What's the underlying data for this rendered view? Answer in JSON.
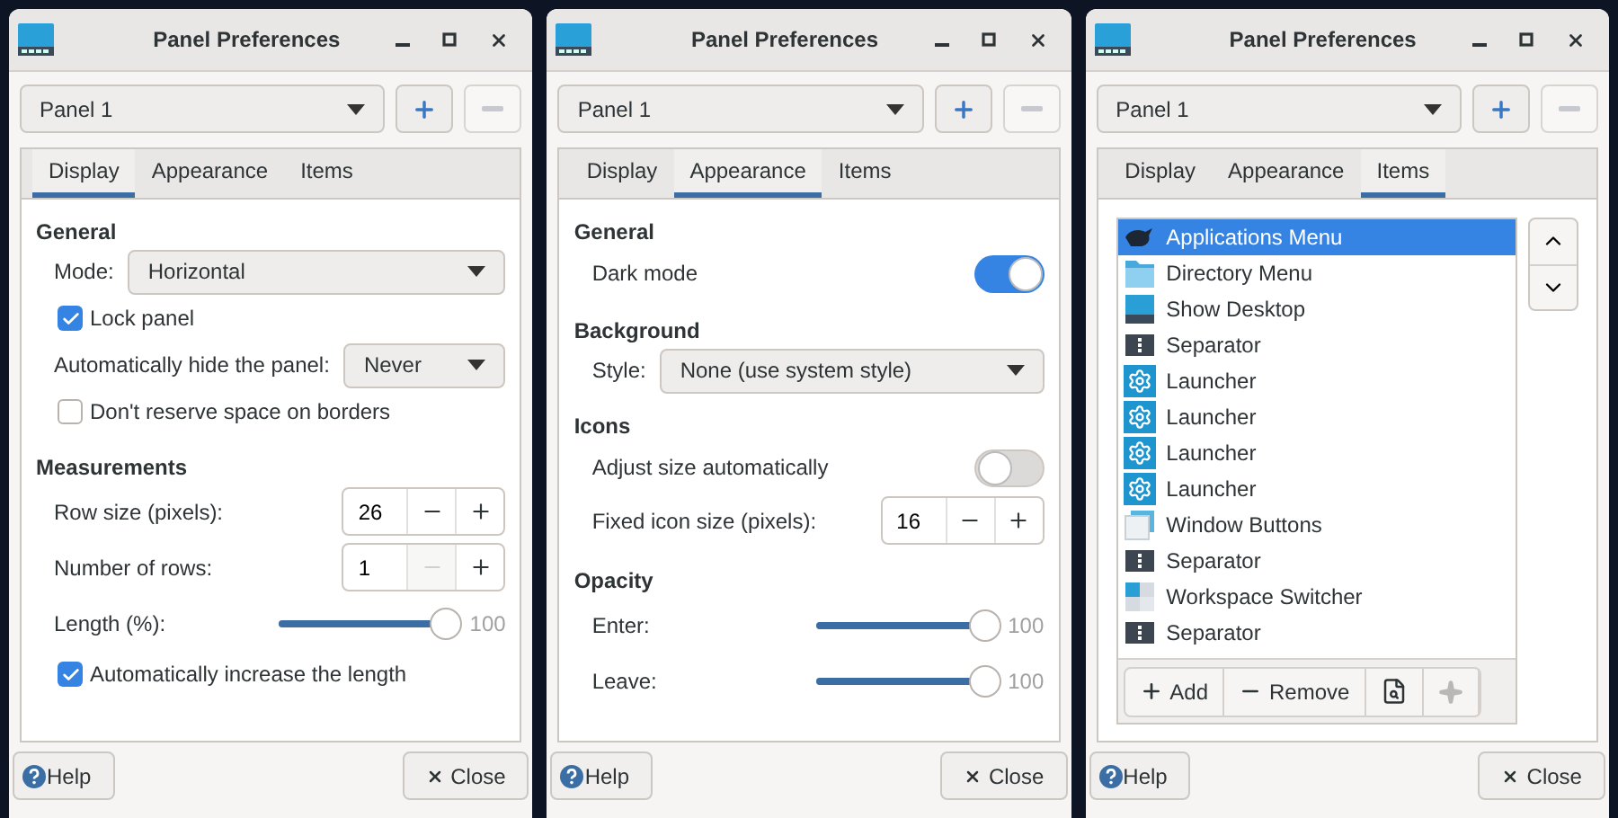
{
  "windows": [
    {
      "title": "Panel Preferences",
      "panel": {
        "value": "Panel 1",
        "remove_disabled": true
      },
      "tabs": [
        {
          "label": "Display",
          "selected": true
        },
        {
          "label": "Appearance",
          "selected": false
        },
        {
          "label": "Items",
          "selected": false
        }
      ],
      "page": {
        "kind": "form",
        "sections": [
          {
            "heading": "General",
            "rows": [
              {
                "kind": "dropdown",
                "label": "Mode:",
                "value": "Horizontal"
              },
              {
                "kind": "checkbox",
                "label": "Lock panel",
                "checked": true
              },
              {
                "kind": "dropdown",
                "label": "Automatically hide the panel:",
                "value": "Never"
              },
              {
                "kind": "checkbox",
                "label": "Don't reserve space on borders",
                "checked": false
              }
            ]
          },
          {
            "heading": "Measurements",
            "rows": [
              {
                "kind": "spin",
                "label": "Row size (pixels):",
                "value": "26",
                "decrement_disabled": false
              },
              {
                "kind": "spin",
                "label": "Number of rows:",
                "value": "1",
                "decrement_disabled": true
              },
              {
                "kind": "slider",
                "label": "Length (%):",
                "level": 1,
                "reading": "100"
              },
              {
                "kind": "checkbox",
                "label": "Automatically increase the length",
                "checked": true
              }
            ]
          }
        ]
      },
      "footer": {
        "help": "Help",
        "close": "Close"
      }
    },
    {
      "title": "Panel Preferences",
      "panel": {
        "value": "Panel 1",
        "remove_disabled": true
      },
      "tabs": [
        {
          "label": "Display",
          "selected": false
        },
        {
          "label": "Appearance",
          "selected": true
        },
        {
          "label": "Items",
          "selected": false
        }
      ],
      "page": {
        "kind": "form",
        "sections": [
          {
            "heading": "General",
            "rows": [
              {
                "kind": "switch",
                "label": "Dark mode",
                "on": true
              }
            ]
          },
          {
            "heading": "Background",
            "rows": [
              {
                "kind": "dropdown",
                "label": "Style:",
                "value": "None (use system style)"
              }
            ]
          },
          {
            "heading": "Icons",
            "rows": [
              {
                "kind": "switch",
                "label": "Adjust size automatically",
                "on": false
              },
              {
                "kind": "spin",
                "label": "Fixed icon size (pixels):",
                "value": "16",
                "decrement_disabled": false
              }
            ]
          },
          {
            "heading": "Opacity",
            "rows": [
              {
                "kind": "slider",
                "label": "Enter:",
                "level": 1,
                "reading": "100"
              },
              {
                "kind": "slider",
                "label": "Leave:",
                "level": 1,
                "reading": "100"
              }
            ]
          }
        ]
      },
      "footer": {
        "help": "Help",
        "close": "Close"
      }
    },
    {
      "title": "Panel Preferences",
      "panel": {
        "value": "Panel 1",
        "remove_disabled": true
      },
      "tabs": [
        {
          "label": "Display",
          "selected": false
        },
        {
          "label": "Appearance",
          "selected": false
        },
        {
          "label": "Items",
          "selected": true
        }
      ],
      "page": {
        "kind": "items",
        "items": [
          {
            "kind": "menu",
            "label": "Applications Menu",
            "selected": true
          },
          {
            "kind": "folder",
            "label": "Directory Menu",
            "selected": false
          },
          {
            "kind": "desktop",
            "label": "Show Desktop",
            "selected": false
          },
          {
            "kind": "separator",
            "label": "Separator",
            "selected": false
          },
          {
            "kind": "launcher",
            "label": "Launcher",
            "selected": false
          },
          {
            "kind": "launcher",
            "label": "Launcher",
            "selected": false
          },
          {
            "kind": "launcher",
            "label": "Launcher",
            "selected": false
          },
          {
            "kind": "launcher",
            "label": "Launcher",
            "selected": false
          },
          {
            "kind": "windows",
            "label": "Window Buttons",
            "selected": false
          },
          {
            "kind": "separator",
            "label": "Separator",
            "selected": false
          },
          {
            "kind": "workspaces",
            "label": "Workspace Switcher",
            "selected": false
          },
          {
            "kind": "separator",
            "label": "Separator",
            "selected": false
          }
        ],
        "toolbar": [
          {
            "kind": "add",
            "label": "Add",
            "disabled": false
          },
          {
            "kind": "remove",
            "label": "Remove",
            "disabled": false
          },
          {
            "kind": "properties",
            "disabled": false
          },
          {
            "kind": "about",
            "disabled": true
          }
        ]
      },
      "footer": {
        "help": "Help",
        "close": "Close"
      }
    }
  ]
}
